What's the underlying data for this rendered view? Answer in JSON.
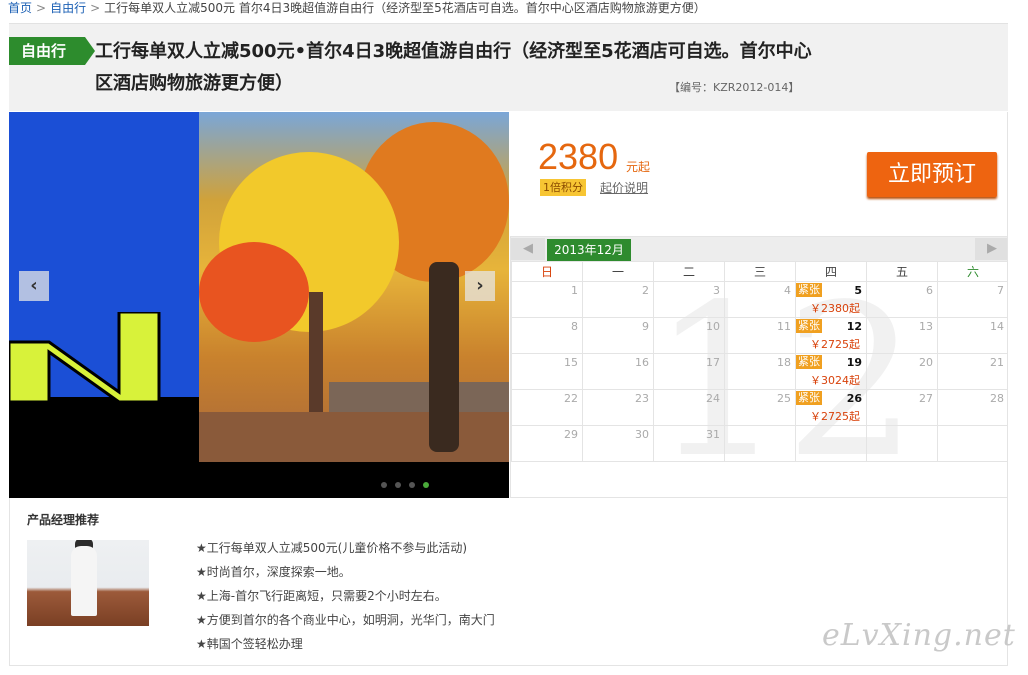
{
  "breadcrumb": {
    "home": "首页",
    "category": "自由行",
    "current": "工行每单双人立减500元 首尔4日3晚超值游自由行（经济型至5花酒店可自选。首尔中心区酒店购物旅游更方便）"
  },
  "product": {
    "tag": "自由行",
    "title": "工行每单双人立减500元•首尔4日3晚超值游自由行（经济型至5花酒店可自选。首尔中心区酒店购物旅游更方便）",
    "code": "【编号：KZR2012-014】"
  },
  "price": {
    "value": "2380",
    "unit": "元起",
    "points": "1倍积分",
    "note": "起价说明",
    "book_label": "立即预订"
  },
  "calendar": {
    "month": "2013年12月",
    "watermark": "12",
    "weekdays": [
      "日",
      "一",
      "二",
      "三",
      "四",
      "五",
      "六"
    ],
    "weeks": [
      [
        {
          "d": "1"
        },
        {
          "d": "2"
        },
        {
          "d": "3"
        },
        {
          "d": "4"
        },
        {
          "d": "5",
          "status": "紧张",
          "price": "￥2380起"
        },
        {
          "d": "6"
        },
        {
          "d": "7"
        }
      ],
      [
        {
          "d": "8"
        },
        {
          "d": "9"
        },
        {
          "d": "10"
        },
        {
          "d": "11"
        },
        {
          "d": "12",
          "status": "紧张",
          "price": "￥2725起"
        },
        {
          "d": "13"
        },
        {
          "d": "14"
        }
      ],
      [
        {
          "d": "15"
        },
        {
          "d": "16"
        },
        {
          "d": "17"
        },
        {
          "d": "18"
        },
        {
          "d": "19",
          "status": "紧张",
          "price": "￥3024起"
        },
        {
          "d": "20"
        },
        {
          "d": "21"
        }
      ],
      [
        {
          "d": "22"
        },
        {
          "d": "23"
        },
        {
          "d": "24"
        },
        {
          "d": "25"
        },
        {
          "d": "26",
          "status": "紧张",
          "price": "￥2725起"
        },
        {
          "d": "27"
        },
        {
          "d": "28"
        }
      ],
      [
        {
          "d": "29"
        },
        {
          "d": "30"
        },
        {
          "d": "31"
        },
        {
          "d": ""
        },
        {
          "d": ""
        },
        {
          "d": ""
        },
        {
          "d": ""
        }
      ]
    ]
  },
  "gallery": {
    "prev_icon": "‹",
    "next_icon": "›",
    "slide_count": 4,
    "active_slide": 4
  },
  "recommend": {
    "title": "产品经理推荐",
    "items": [
      "★工行每单双人立减500元(儿童价格不参与此活动)",
      "★时尚首尔，深度探索一地。",
      "★上海-首尔飞行距离短，只需要2个小时左右。",
      "★方便到首尔的各个商业中心，如明洞，光华门，南大门",
      "★韩国个签轻松办理"
    ]
  },
  "watermark": "eLvXing.net",
  "colors": {
    "accent_green": "#2d8c2d",
    "price_orange": "#e5670f",
    "link_blue": "#1a5fb4"
  }
}
